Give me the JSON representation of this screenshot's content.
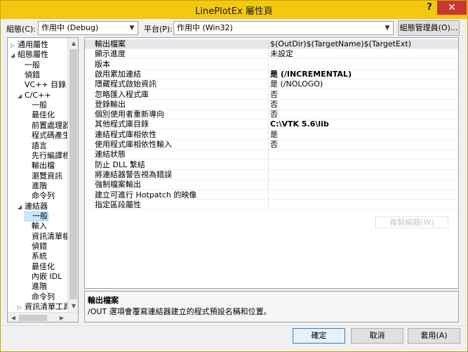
{
  "window": {
    "title": "LinePlotEx 屬性頁",
    "help_label": "?",
    "close_label": "✕"
  },
  "config_bar": {
    "config_label": "組態(C):",
    "config_value": "作用中 (Debug)",
    "platform_label": "平台(P):",
    "platform_value": "作用中 (Win32)",
    "manager_button": "組態管理員(O)..."
  },
  "tree": {
    "items": [
      {
        "label": "通用屬性",
        "level": 0,
        "exp": "▷"
      },
      {
        "label": "組態屬性",
        "level": 0,
        "exp": "◢"
      },
      {
        "label": "一般",
        "level": 1,
        "exp": ""
      },
      {
        "label": "偵錯",
        "level": 1,
        "exp": ""
      },
      {
        "label": "VC++ 目錄",
        "level": 1,
        "exp": ""
      },
      {
        "label": "C/C++",
        "level": 1,
        "exp": "◢"
      },
      {
        "label": "一般",
        "level": 2,
        "exp": ""
      },
      {
        "label": "最佳化",
        "level": 2,
        "exp": ""
      },
      {
        "label": "前置處理器",
        "level": 2,
        "exp": ""
      },
      {
        "label": "程式碼產生",
        "level": 2,
        "exp": ""
      },
      {
        "label": "語言",
        "level": 2,
        "exp": ""
      },
      {
        "label": "先行編譯標頭",
        "level": 2,
        "exp": ""
      },
      {
        "label": "輸出檔",
        "level": 2,
        "exp": ""
      },
      {
        "label": "瀏覽資訊",
        "level": 2,
        "exp": ""
      },
      {
        "label": "進階",
        "level": 2,
        "exp": ""
      },
      {
        "label": "命令列",
        "level": 2,
        "exp": ""
      },
      {
        "label": "連結器",
        "level": 1,
        "exp": "◢"
      },
      {
        "label": "一般",
        "level": 2,
        "exp": "",
        "selected": true
      },
      {
        "label": "輸入",
        "level": 2,
        "exp": ""
      },
      {
        "label": "資訊清單檔",
        "level": 2,
        "exp": ""
      },
      {
        "label": "偵錯",
        "level": 2,
        "exp": ""
      },
      {
        "label": "系統",
        "level": 2,
        "exp": ""
      },
      {
        "label": "最佳化",
        "level": 2,
        "exp": ""
      },
      {
        "label": "內嵌 IDL",
        "level": 2,
        "exp": ""
      },
      {
        "label": "進階",
        "level": 2,
        "exp": ""
      },
      {
        "label": "命令列",
        "level": 2,
        "exp": ""
      },
      {
        "label": "資訊清單工具",
        "level": 1,
        "exp": "▷"
      }
    ],
    "scroll_up": "▲",
    "scroll_down": "▼",
    "scroll_left": "◀",
    "scroll_right": "▶"
  },
  "grid": {
    "rows": [
      {
        "name": "輸出檔案",
        "value": "$(OutDir)$(TargetName)$(TargetExt)",
        "bold": false,
        "selected": true
      },
      {
        "name": "顯示進度",
        "value": "未設定",
        "bold": false
      },
      {
        "name": "版本",
        "value": "",
        "bold": false
      },
      {
        "name": "啟用累加連結",
        "value": "是 (/INCREMENTAL)",
        "bold": true
      },
      {
        "name": "隱藏程式啟始資訊",
        "value": "是 (/NOLOGO)",
        "bold": false
      },
      {
        "name": "忽略匯入程式庫",
        "value": "否",
        "bold": false
      },
      {
        "name": "登錄輸出",
        "value": "否",
        "bold": false
      },
      {
        "name": "個別使用者重新導向",
        "value": "否",
        "bold": false
      },
      {
        "name": "其他程式庫目錄",
        "value": "C:\\VTK 5.6\\lib",
        "bold": true
      },
      {
        "name": "連結程式庫相依性",
        "value": "是",
        "bold": false
      },
      {
        "name": "使用程式庫相依性輸入",
        "value": "否",
        "bold": false
      },
      {
        "name": "連結狀態",
        "value": "",
        "bold": false
      },
      {
        "name": "防止 DLL 繫結",
        "value": "",
        "bold": false
      },
      {
        "name": "將連結器警告視為錯誤",
        "value": "",
        "bold": false
      },
      {
        "name": "強制檔案輸出",
        "value": "",
        "bold": false
      },
      {
        "name": "建立可進行 Hotpatch 的映像",
        "value": "",
        "bold": false
      },
      {
        "name": "指定區段屬性",
        "value": "",
        "bold": false
      }
    ],
    "disabled_button": "複製編輯(W)"
  },
  "description": {
    "title": "輸出檔案",
    "text": "/OUT 選項會覆寫連結器建立的程式預設名稱和位置。"
  },
  "footer": {
    "ok": "確定",
    "cancel": "取消",
    "apply": "套用(A)"
  }
}
